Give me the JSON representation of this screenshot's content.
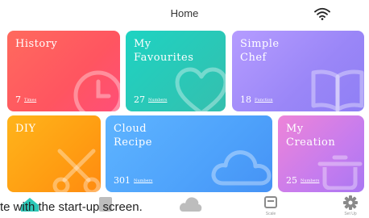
{
  "header": {
    "title": "Home",
    "wifi_icon": "wifi-icon"
  },
  "cards": [
    {
      "id": "history",
      "title": "History",
      "count": "7",
      "unit": "Times",
      "icon": "clock-icon"
    },
    {
      "id": "favourites",
      "title": "My\nFavourites",
      "count": "27",
      "unit": "Numbers",
      "icon": "heart-icon"
    },
    {
      "id": "chef",
      "title": "Simple\nChef",
      "count": "18",
      "unit": "Function",
      "icon": "book-icon"
    },
    {
      "id": "diy",
      "title": "DIY",
      "icon": "scissors-icon"
    },
    {
      "id": "cloud",
      "title": "Cloud\nRecipe",
      "count": "301",
      "unit": "Numbers",
      "icon": "cloud-icon"
    },
    {
      "id": "creation",
      "title": "My\nCreation",
      "count": "25",
      "unit": "Numbers",
      "icon": "pot-icon"
    }
  ],
  "caption": "te with the start-up screen.",
  "nav": {
    "scale": {
      "label": "Scale",
      "icon": "scale-icon"
    },
    "setup": {
      "label": "Set Up",
      "icon": "gear-icon"
    }
  },
  "colors": {
    "history": "#ff5a5f",
    "favourites": "#2cc8b8",
    "chef": "#9c88f8",
    "diy": "#ffa014",
    "cloud": "#52a6fc",
    "creation": "#d07fe6",
    "nav_teal": "#2cc8b8"
  }
}
